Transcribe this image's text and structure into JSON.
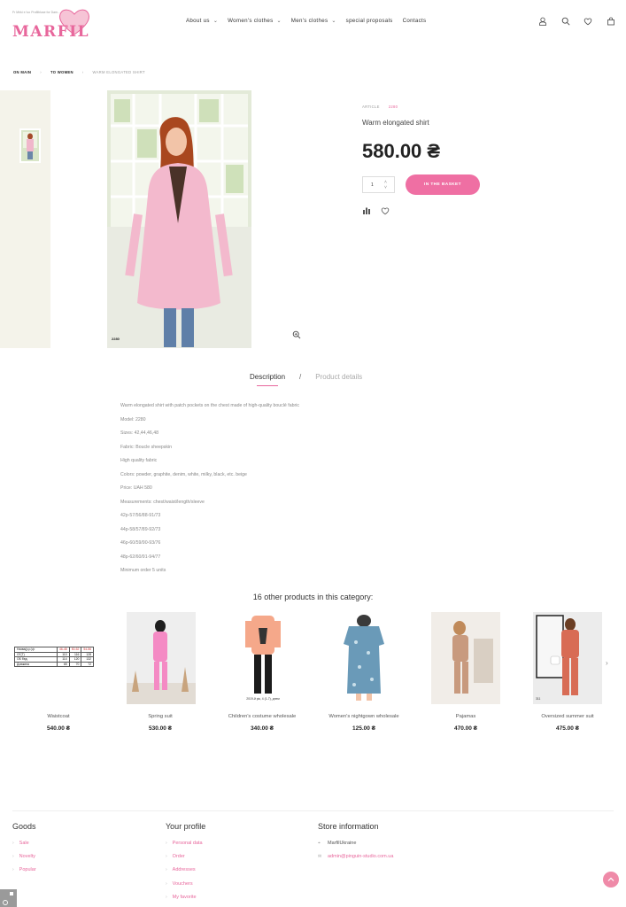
{
  "header": {
    "logo_tagline": "Fr Mirki e Ivo Profilbluse for Dam...",
    "logo_text": "MARFIL",
    "nav": [
      {
        "label": "About us",
        "has_dropdown": true
      },
      {
        "label": "Women's clothes",
        "has_dropdown": true
      },
      {
        "label": "Men's clothes",
        "has_dropdown": true
      },
      {
        "label": "special proposals",
        "has_dropdown": false
      },
      {
        "label": "Contacts",
        "has_dropdown": false
      }
    ],
    "icons": [
      "user-icon",
      "search-icon",
      "heart-icon",
      "cart-icon"
    ]
  },
  "breadcrumb": {
    "items": [
      "ON MAIN",
      "TO WOMEN"
    ],
    "current": "WARM ELONGATED SHIRT"
  },
  "gallery": {
    "photo_code": "2280"
  },
  "product": {
    "article_label": "ARTICLE",
    "article_value": "2280",
    "name": "Warm elongated shirt",
    "price": "580.00 ₴",
    "quantity": "1",
    "basket_label": "IN THE BASKET"
  },
  "tabs": {
    "active": "Description",
    "separator": "/",
    "inactive": "Product details"
  },
  "description": [
    "Warm elongated shirt with patch pockets on the chest made of high-quality bouclé fabric",
    "Model: 2280",
    "Sizes: 42,44,46,48",
    "Fabric: Boucle sheepskin",
    "High quality fabric",
    "Colors: powder, graphite, denim, white, milky, black, etc. beige",
    "Price: UAH 580",
    "Measurements: chest/waist/length/sleeve",
    "42p-57/56/88-91/73",
    "44p-58/57/89-92/73",
    "46p-60/59/90-93/76",
    "48p-62/60/91-94/77",
    "Minimum order 5 units"
  ],
  "related": {
    "title": "16 other products in this category:",
    "products": [
      {
        "name": "Waistcoat",
        "price": "540.00 ₴"
      },
      {
        "name": "Spring suit",
        "price": "530.00 ₴"
      },
      {
        "name": "Children's costume wholesale",
        "price": "340.00 ₴"
      },
      {
        "name": "Women's nightgown wholesale",
        "price": "125.00 ₴"
      },
      {
        "name": "Pajamas",
        "price": "470.00 ₴"
      },
      {
        "name": "Oversized summer suit",
        "price": "475.00 ₴"
      }
    ],
    "size_table": {
      "rows": [
        [
          "Назва(р.р.)/р",
          "46-48",
          "50-52",
          "54-56"
        ],
        [
          "ОГ(Т)",
          "110",
          "116",
          "128"
        ],
        [
          "ОБ бед.",
          "114",
          "120",
          "132"
        ],
        [
          "Довжина",
          "65",
          "70",
          "72"
        ]
      ]
    },
    "card3_caption": "2019-й рік, 4 (1-7), днем",
    "card6_caption": "311"
  },
  "footer": {
    "goods": {
      "title": "Goods",
      "links": [
        "Sale",
        "Novelty",
        "Popular"
      ]
    },
    "profile": {
      "title": "Your profile",
      "links": [
        "Personal data",
        "Order",
        "Addresses",
        "Vouchers",
        "My favorite"
      ]
    },
    "store": {
      "title": "Store information",
      "name": "MarfilUkraine",
      "email": "admin@pinguin-studio.com.ua"
    }
  },
  "colors": {
    "accent": "#e8679c",
    "button": "#ef6fa3"
  }
}
